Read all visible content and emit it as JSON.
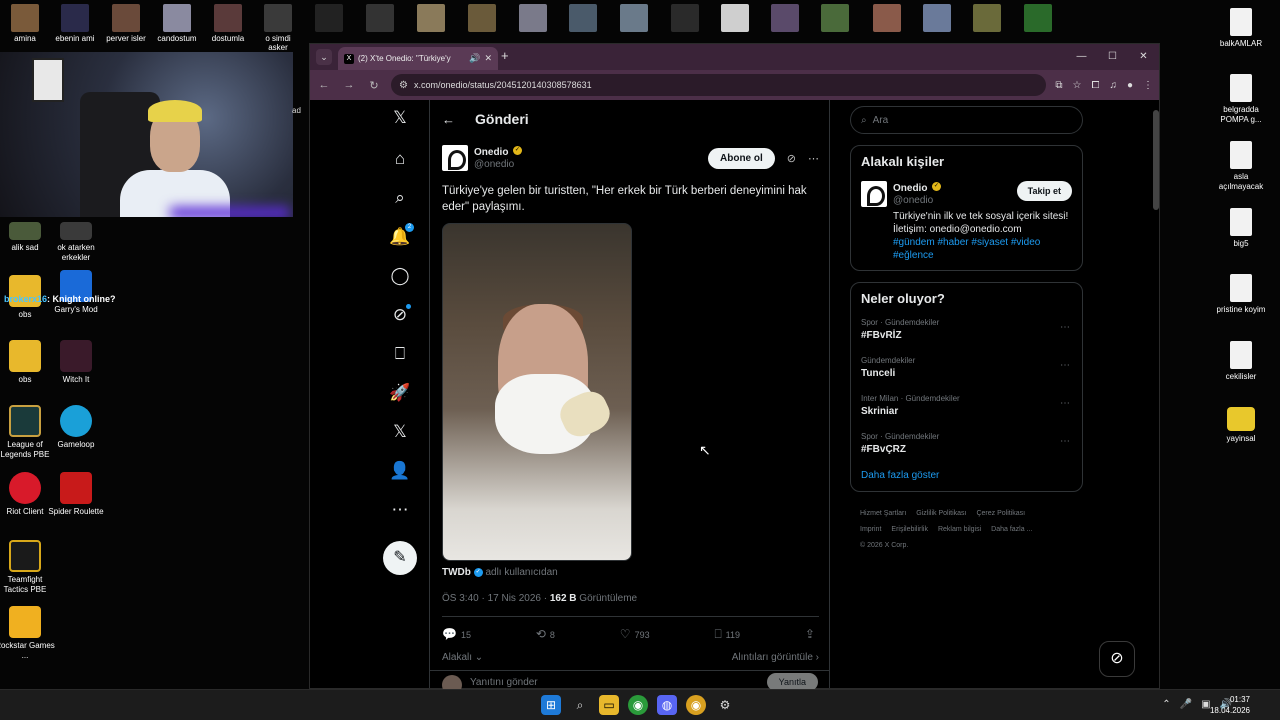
{
  "desktop": {
    "top_icons": [
      "amina",
      "ebenin ami",
      "perver isler",
      "candostum",
      "dostumla",
      "o simdi asker",
      "",
      "",
      "",
      "",
      "",
      "",
      "",
      "",
      "",
      "",
      "",
      "",
      "",
      "",
      ""
    ],
    "left_icons": [
      {
        "label": "alik sad"
      },
      {
        "label": "ok atarken erkekler"
      },
      {
        "label": "obs"
      },
      {
        "label": "Garry's Mod"
      },
      {
        "label": "obs"
      },
      {
        "label": "Witch It"
      },
      {
        "label": "League of Legends PBE"
      },
      {
        "label": "Gameloop"
      },
      {
        "label": "Riot Client"
      },
      {
        "label": "Spider Roulette"
      },
      {
        "label": "Teamfight Tactics PBE"
      },
      {
        "label": "Rockstar Games ..."
      }
    ],
    "right_icons": [
      "balkAMLAR",
      "belgradda POMPA g...",
      "asla açılmayacak",
      "big5",
      "pristine koyim",
      "cekilisler",
      "yayinsal"
    ],
    "stream_overlay": {
      "user": "brokerx16",
      "message": ": Knight online?"
    },
    "stray_label": "ad"
  },
  "browser": {
    "tab_title": "(2) X'te Onedio: \"Türkiye'y",
    "url": "x.com/onedio/status/2045120140308578631",
    "window_controls": [
      "—",
      "☐",
      "✕"
    ]
  },
  "x": {
    "header_title": "Gönderi",
    "notification_count": "2",
    "post": {
      "author_name": "Onedio",
      "author_handle": "@onedio",
      "follow_label": "Abone ol",
      "text": "Türkiye'ye gelen bir turistten, \"Her erkek bir Türk berberi deneyimini hak eder\" paylaşımı.",
      "credit_name": "TWDb",
      "credit_suffix": "adlı kullanıcıdan",
      "time": "ÖS 3:40 · 17 Nis 2026 · ",
      "views_count": "162 B",
      "views_label": " Görüntüleme",
      "replies": "15",
      "reposts": "8",
      "likes": "793",
      "bookmarks": "119",
      "sort_label": "Alakalı",
      "quotes_label": "Alıntıları görüntüle",
      "reply_placeholder": "Yanıtını gönder",
      "reply_button": "Yanıtla"
    },
    "search_placeholder": "Ara",
    "related": {
      "title": "Alakalı kişiler",
      "name": "Onedio",
      "handle": "@onedio",
      "follow_label": "Takip et",
      "bio": "Türkiye'nin ilk ve tek sosyal içerik sitesi! İletişim: onedio@onedio.com",
      "tags": "#gündem #haber #siyaset #video #eğlence"
    },
    "trends": {
      "title": "Neler oluyor?",
      "items": [
        {
          "category": "Spor · Gündemdekiler",
          "name": "#FBvRİZ"
        },
        {
          "category": "Gündemdekiler",
          "name": "Tunceli"
        },
        {
          "category": "Inter Milan · Gündemdekiler",
          "name": "Skriniar"
        },
        {
          "category": "Spor · Gündemdekiler",
          "name": "#FBvÇRZ"
        }
      ],
      "more_label": "Daha fazla göster"
    },
    "footer": {
      "links1": [
        "Hizmet Şartları",
        "Gizlilik Politikası",
        "Çerez Politikası"
      ],
      "links2": [
        "Imprint",
        "Erişilebilirlik",
        "Reklam bilgisi",
        "Daha fazla ..."
      ],
      "copyright": "© 2026 X Corp."
    }
  },
  "taskbar": {
    "time": "01:37",
    "date": "18.04.2026"
  }
}
